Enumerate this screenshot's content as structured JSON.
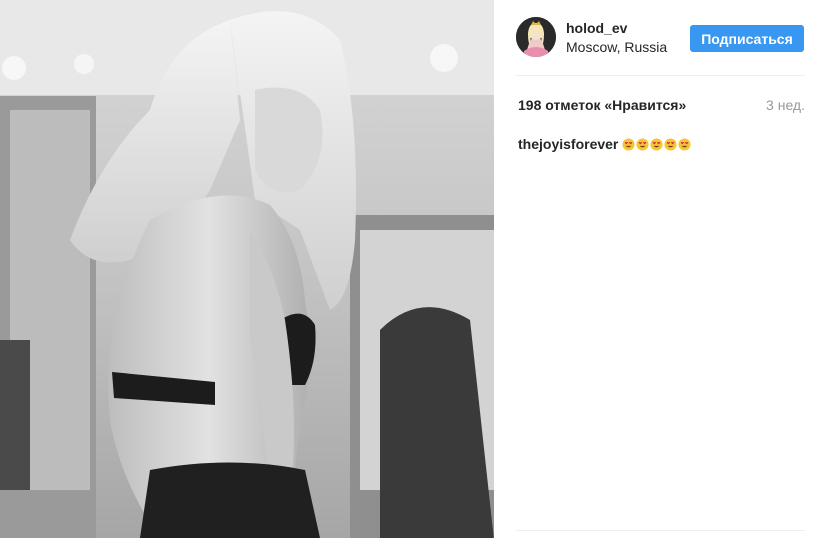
{
  "post": {
    "photo_alt": "",
    "author": {
      "username": "holod_ev",
      "location": "Moscow, Russia",
      "follow_label": "Подписаться"
    },
    "likes_text": "198 отметок «Нравится»",
    "time_text": "3 нед.",
    "caption": {
      "username": "thejoyisforever",
      "emoji_count": 5,
      "emoji_icon": "smiling-face-with-heart-eyes-icon"
    }
  },
  "colors": {
    "accent": "#3897f0",
    "text": "#262626",
    "muted": "#999999",
    "divider": "#efefef"
  }
}
